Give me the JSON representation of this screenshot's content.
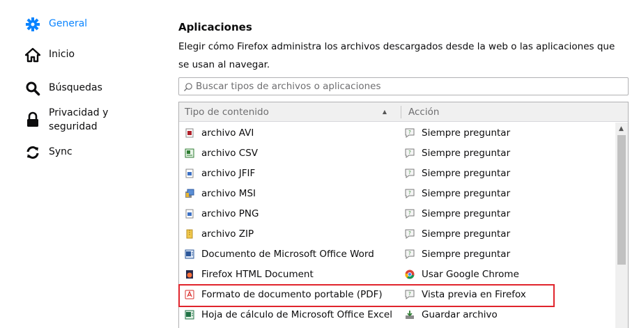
{
  "sidebar": {
    "items": [
      {
        "label": "General",
        "icon": "gear-icon",
        "active": true
      },
      {
        "label": "Inicio",
        "icon": "home-icon"
      },
      {
        "label": "Búsquedas",
        "icon": "search-icon"
      },
      {
        "label": "Privacidad y seguridad",
        "icon": "lock-icon"
      },
      {
        "label": "Sync",
        "icon": "sync-icon"
      }
    ]
  },
  "section": {
    "title": "Aplicaciones",
    "description": "Elegir cómo Firefox administra los archivos descargados desde la web o las aplicaciones que se usan al navegar."
  },
  "search": {
    "placeholder": "Buscar tipos de archivos o aplicaciones",
    "value": ""
  },
  "table": {
    "col_type": "Tipo de contenido",
    "col_action": "Acción",
    "rows": [
      {
        "type": "archivo AVI",
        "type_icon": "avi-file-icon",
        "action": "Siempre preguntar",
        "action_icon": "ask-icon"
      },
      {
        "type": "archivo CSV",
        "type_icon": "csv-file-icon",
        "action": "Siempre preguntar",
        "action_icon": "ask-icon"
      },
      {
        "type": "archivo JFIF",
        "type_icon": "jfif-file-icon",
        "action": "Siempre preguntar",
        "action_icon": "ask-icon"
      },
      {
        "type": "archivo MSI",
        "type_icon": "msi-file-icon",
        "action": "Siempre preguntar",
        "action_icon": "ask-icon"
      },
      {
        "type": "archivo PNG",
        "type_icon": "png-file-icon",
        "action": "Siempre preguntar",
        "action_icon": "ask-icon"
      },
      {
        "type": "archivo ZIP",
        "type_icon": "zip-file-icon",
        "action": "Siempre preguntar",
        "action_icon": "ask-icon"
      },
      {
        "type": "Documento de Microsoft Office Word",
        "type_icon": "word-file-icon",
        "action": "Siempre preguntar",
        "action_icon": "ask-icon"
      },
      {
        "type": "Firefox HTML Document",
        "type_icon": "firefox-html-icon",
        "action": "Usar Google Chrome",
        "action_icon": "chrome-icon"
      },
      {
        "type": "Formato de documento portable (PDF)",
        "type_icon": "pdf-file-icon",
        "action": "Vista previa en Firefox",
        "action_icon": "preview-icon",
        "highlighted": true
      },
      {
        "type": "Hoja de cálculo de Microsoft Office Excel",
        "type_icon": "excel-file-icon",
        "action": "Guardar archivo",
        "action_icon": "save-icon"
      }
    ]
  },
  "colors": {
    "accent": "#0a84ff",
    "highlight_border": "#e0242c"
  }
}
